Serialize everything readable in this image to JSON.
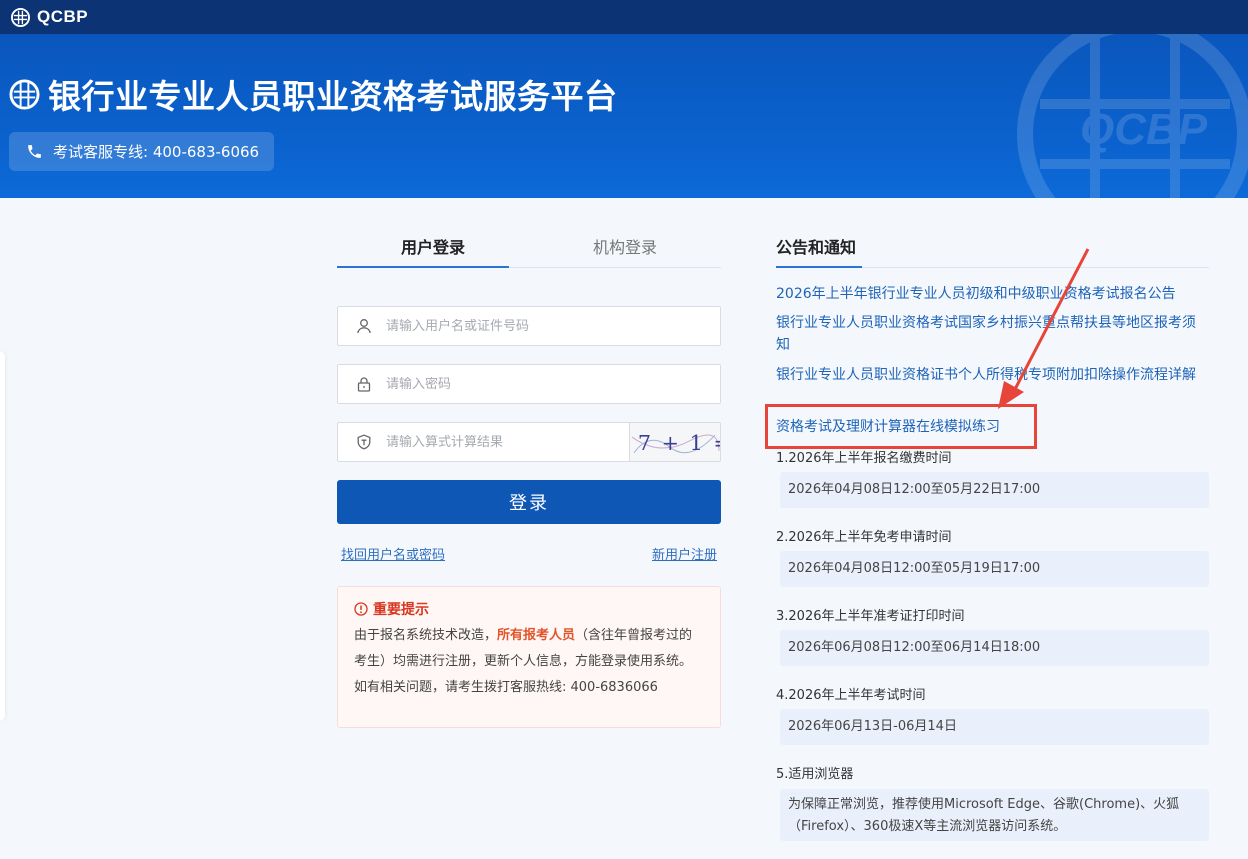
{
  "topbar": {
    "brand": "QCBP"
  },
  "hero": {
    "title": "银行业专业人员职业资格考试服务平台",
    "hotline": "考试客服专线: 400-683-6066",
    "watermark": "QCBP"
  },
  "login": {
    "tabs": [
      "用户登录",
      "机构登录"
    ],
    "username_placeholder": "请输入用户名或证件号码",
    "password_placeholder": "请输入密码",
    "captcha_placeholder": "请输入算式计算结果",
    "captcha_text": "7 + 1 =",
    "login_button": "登录",
    "forgot_link": "找回用户名或密码",
    "register_link": "新用户注册"
  },
  "notice": {
    "title": "重要提示",
    "text_before": "由于报名系统技术改造，",
    "highlight": "所有报考人员",
    "text_after": "（含往年曾报考过的考生）均需进行注册，更新个人信息，方能登录使用系统。如有相关问题，请考生拨打客服热线: 400-6836066"
  },
  "news": {
    "title": "公告和通知",
    "links": [
      "2026年上半年银行业专业人员初级和中级职业资格考试报名公告",
      "银行业专业人员职业资格考试国家乡村振兴重点帮扶县等地区报考须知",
      "银行业专业人员职业资格证书个人所得税专项附加扣除操作流程详解",
      "资格考试及理财计算器在线模拟练习"
    ],
    "sections": [
      {
        "label": "1.2026年上半年报名缴费时间",
        "value": "2026年04月08日12:00至05月22日17:00"
      },
      {
        "label": "2.2026年上半年免考申请时间",
        "value": "2026年04月08日12:00至05月19日17:00"
      },
      {
        "label": "3.2026年上半年准考证打印时间",
        "value": "2026年06月08日12:00至06月14日18:00"
      },
      {
        "label": "4.2026年上半年考试时间",
        "value": "2026年06月13日-06月14日"
      },
      {
        "label": "5.适用浏览器",
        "value": "为保障正常浏览，推荐使用Microsoft Edge、谷歌(Chrome)、火狐（Firefox）、360极速X等主流浏览器访问系统。"
      }
    ]
  },
  "colors": {
    "hero_blue": "#0b63cf",
    "topbar_navy": "#0c3474",
    "button_blue": "#0f57b5",
    "link_blue": "#1e63b8",
    "annotation_red": "#e8453a",
    "notice_red": "#d9361f"
  }
}
